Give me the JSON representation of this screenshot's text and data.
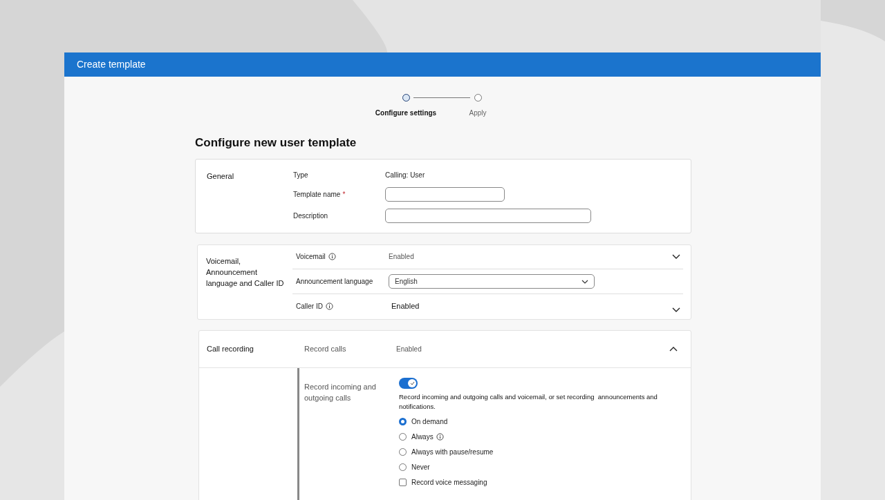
{
  "window": {
    "title": "Create template"
  },
  "stepper": [
    {
      "label": "Configure settings",
      "selected": true
    },
    {
      "label": "Apply",
      "selected": false
    }
  ],
  "heading": "Configure new user template",
  "general": {
    "title": "General",
    "fields": [
      {
        "kind": "text",
        "label": "Type",
        "value": "Calling: User"
      },
      {
        "kind": "input",
        "label": "Template name",
        "required_mark": "*"
      },
      {
        "kind": "input",
        "label": "Description"
      }
    ]
  },
  "voicemail": {
    "title": "Voicemail, Announcement language and Caller ID",
    "rows": [
      {
        "kind": "collapsible",
        "label": "Voicemail",
        "info": true,
        "value": "Enabled",
        "expanded": false
      },
      {
        "kind": "select",
        "label": "Announcement language",
        "value": "English"
      },
      {
        "kind": "collapsible",
        "label": "Caller ID",
        "info": true,
        "value": "Enabled",
        "expanded": false
      }
    ]
  },
  "call_recording": {
    "title": "Call recording",
    "label": "Record calls",
    "value": "Enabled",
    "expanded": true,
    "setting": {
      "label": "Record incoming and outgoing calls",
      "on": true,
      "description": "Record incoming and outgoing calls and voicemail, or set recording  announcements and notifications.",
      "options": [
        {
          "kind": "radio",
          "label": "On demand",
          "selected": true,
          "info": false
        },
        {
          "kind": "radio",
          "label": "Always",
          "selected": false,
          "info": true
        },
        {
          "kind": "radio",
          "label": "Always with pause/resume",
          "selected": false,
          "info": false
        },
        {
          "kind": "radio",
          "label": "Never",
          "selected": false,
          "info": false
        },
        {
          "kind": "checkbox",
          "label": "Record voice messaging",
          "checked": false
        }
      ]
    }
  }
}
